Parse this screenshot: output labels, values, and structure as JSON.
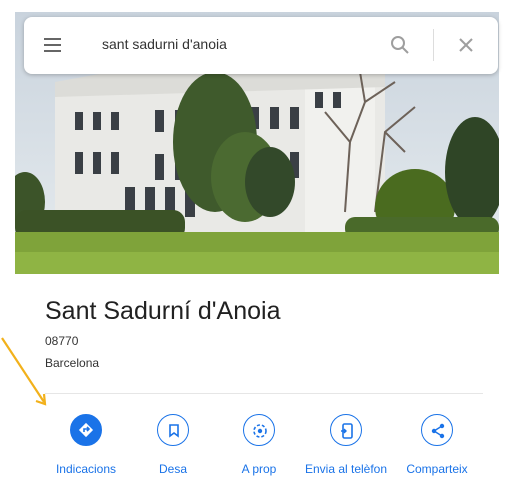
{
  "search": {
    "query": "sant sadurni d'anoia",
    "menu_icon": "hamburger-menu-icon",
    "search_icon": "magnifier-icon",
    "close_icon": "close-icon"
  },
  "place": {
    "name": "Sant Sadurní d'Anoia",
    "postcode": "08770",
    "region": "Barcelona"
  },
  "actions": [
    {
      "label": "Indicacions",
      "icon": "directions-icon"
    },
    {
      "label": "Desa",
      "icon": "bookmark-icon"
    },
    {
      "label": "A prop",
      "icon": "nearby-icon"
    },
    {
      "label": "Envia al telèfon",
      "icon": "send-to-phone-icon"
    },
    {
      "label": "Comparteix",
      "icon": "share-icon"
    }
  ],
  "colors": {
    "accent": "#1a73e8",
    "annotation_arrow": "#f2b11b"
  }
}
